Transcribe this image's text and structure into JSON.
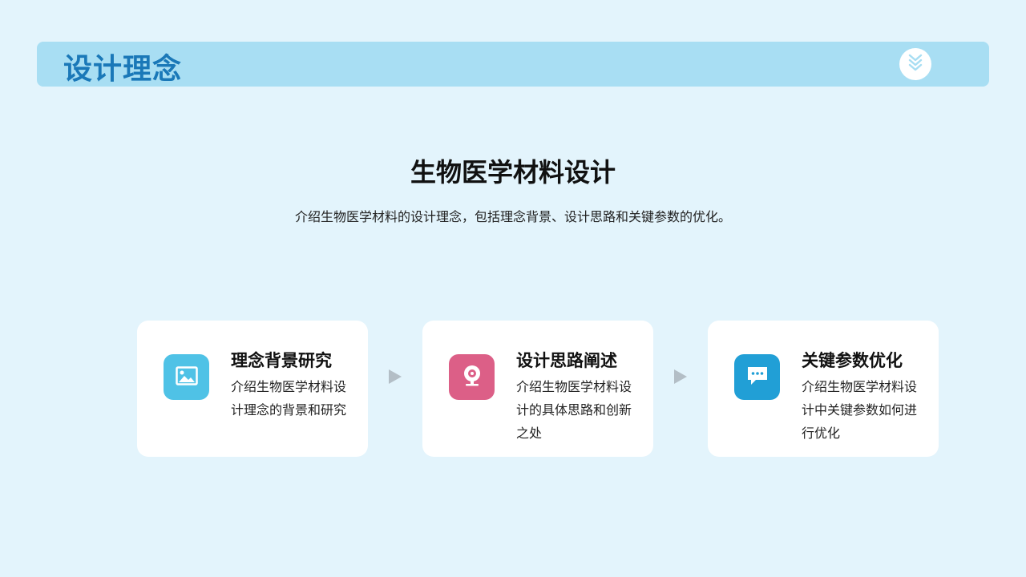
{
  "header": {
    "title": "设计理念",
    "badge_icon": "double-chevron-down-icon"
  },
  "main": {
    "title": "生物医学材料设计",
    "subtitle": "介绍生物医学材料的设计理念，包括理念背景、设计思路和关键参数的优化。"
  },
  "cards": [
    {
      "title": "理念背景研究",
      "description": "介绍生物医学材料设计理念的背景和研究",
      "icon": "image-icon",
      "icon_color": "#4fc2e6"
    },
    {
      "title": "设计思路阐述",
      "description": "介绍生物医学材料设计的具体思路和创新之处",
      "icon": "webcam-icon",
      "icon_color": "#dc5f87"
    },
    {
      "title": "关键参数优化",
      "description": "介绍生物医学材料设计中关键参数如何进行优化",
      "icon": "chat-bubble-icon",
      "icon_color": "#219fd6"
    }
  ],
  "colors": {
    "background": "#e3f4fc",
    "header_bar": "#a8def3",
    "header_title": "#1a78b8",
    "arrow": "#b3bec6"
  }
}
